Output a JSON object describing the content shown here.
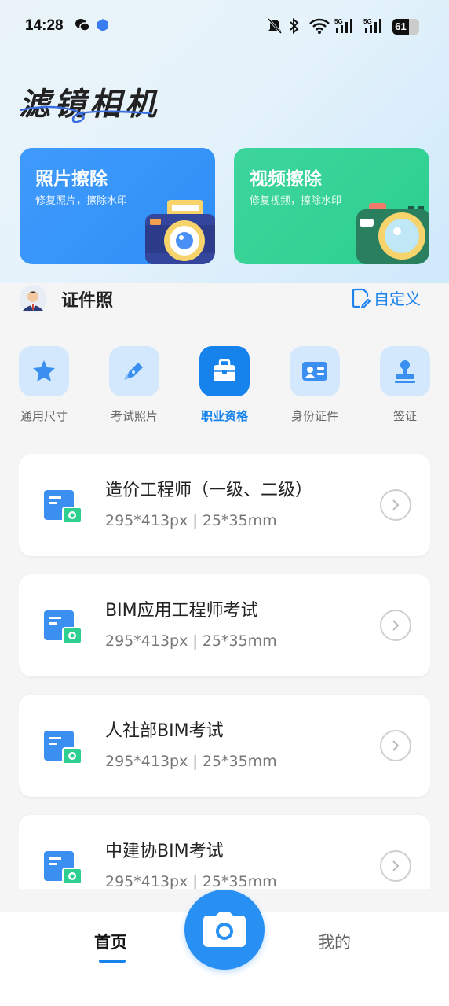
{
  "status_bar": {
    "time": "14:28",
    "battery": "61"
  },
  "app": {
    "title": "滤镜相机"
  },
  "features": [
    {
      "title": "照片擦除",
      "subtitle": "修复照片，擦除水印"
    },
    {
      "title": "视频擦除",
      "subtitle": "修复视频，擦除水印"
    }
  ],
  "section": {
    "title": "证件照",
    "custom_label": "自定义"
  },
  "categories": [
    {
      "label": "通用尺寸",
      "icon": "star-icon"
    },
    {
      "label": "考试照片",
      "icon": "pen-icon"
    },
    {
      "label": "职业资格",
      "icon": "briefcase-icon",
      "active": true
    },
    {
      "label": "身份证件",
      "icon": "id-card-icon"
    },
    {
      "label": "签证",
      "icon": "stamp-icon"
    }
  ],
  "items": [
    {
      "name": "造价工程师（一级、二级）",
      "spec": "295*413px | 25*35mm"
    },
    {
      "name": "BIM应用工程师考试",
      "spec": "295*413px | 25*35mm"
    },
    {
      "name": "人社部BIM考试",
      "spec": "295*413px | 25*35mm"
    },
    {
      "name": "中建协BIM考试",
      "spec": "295*413px | 25*35mm"
    }
  ],
  "bottom_nav": {
    "home": "首页",
    "mine": "我的"
  },
  "colors": {
    "accent": "#1683ed",
    "photo_card": "#3a97fa",
    "video_card": "#35d397"
  }
}
